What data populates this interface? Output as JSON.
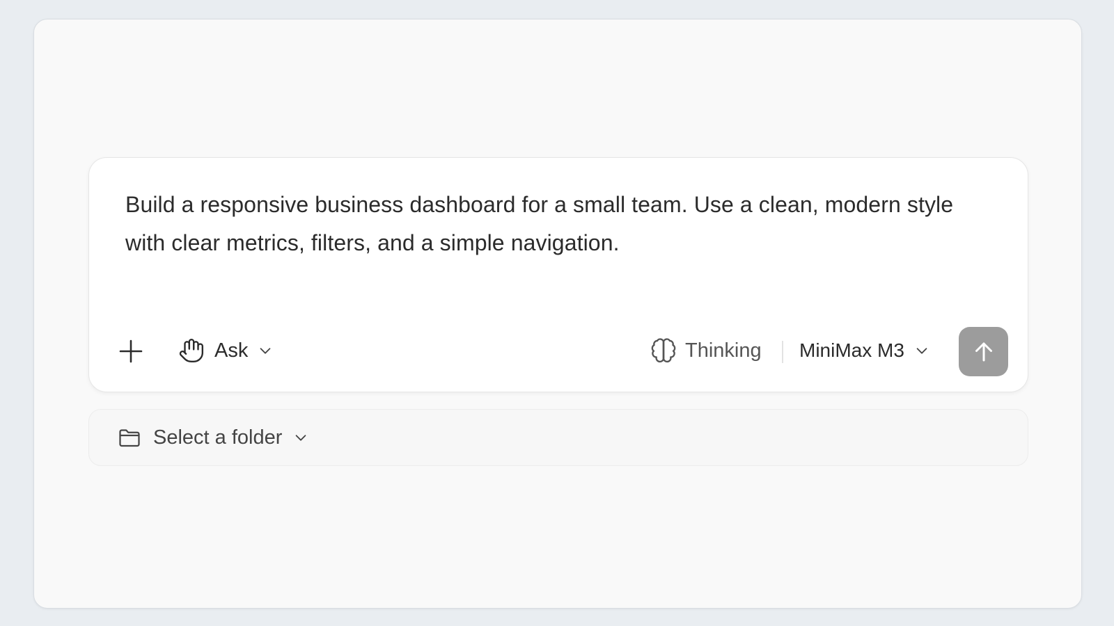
{
  "composer": {
    "prompt": "Build a responsive business dashboard for a small team. Use a clean, modern style with clear metrics, filters, and a simple navigation.",
    "toolbar": {
      "add_icon": "plus-icon",
      "mode": {
        "icon": "hand-icon",
        "label": "Ask",
        "chevron_icon": "chevron-down-icon"
      },
      "thinking": {
        "icon": "brain-icon",
        "label": "Thinking"
      },
      "model": {
        "label": "MiniMax M3",
        "chevron_icon": "chevron-down-icon"
      },
      "send": {
        "icon": "arrow-up-icon",
        "color": "#9c9c9c"
      }
    }
  },
  "folder_selector": {
    "icon": "folder-icon",
    "label": "Select a folder",
    "chevron_icon": "chevron-down-icon"
  }
}
